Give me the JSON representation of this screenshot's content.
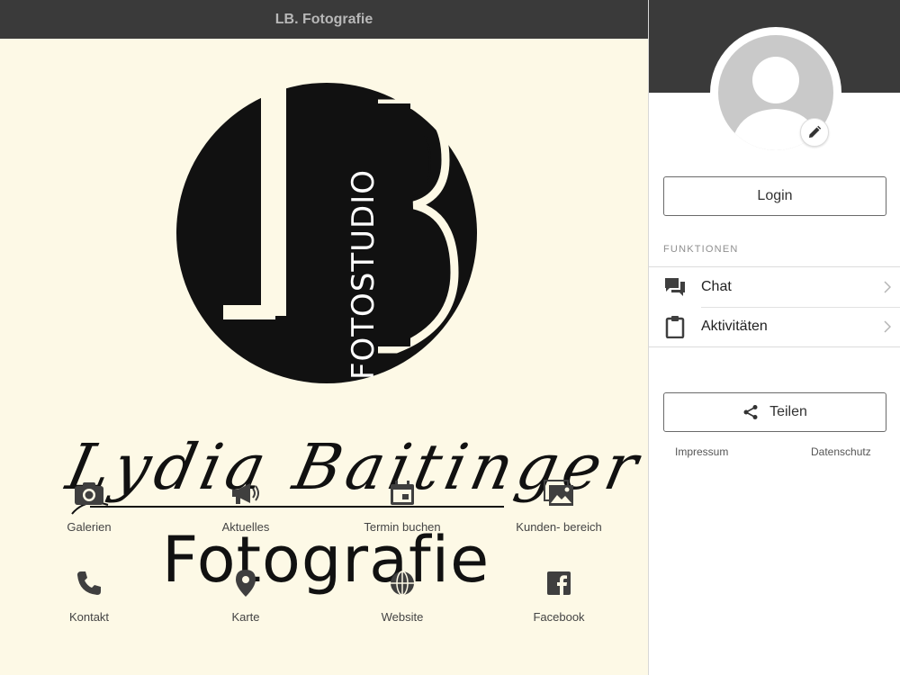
{
  "app": {
    "title": "LB. Fotografie"
  },
  "logo": {
    "vertical_text": "FOTOSTUDIO",
    "name_script": "Lydia Baitinger",
    "subtitle": "Fotografie",
    "ink_color": "#111111",
    "background_color": "#fdf9e6"
  },
  "tiles": [
    {
      "label": "Galerien",
      "icon": "camera-icon"
    },
    {
      "label": "Aktuelles",
      "icon": "megaphone-icon"
    },
    {
      "label": "Termin buchen",
      "icon": "calendar-icon"
    },
    {
      "label": "Kunden- bereich",
      "icon": "photos-icon"
    },
    {
      "label": "Kontakt",
      "icon": "phone-icon"
    },
    {
      "label": "Karte",
      "icon": "map-pin-icon"
    },
    {
      "label": "Website",
      "icon": "globe-icon"
    },
    {
      "label": "Facebook",
      "icon": "facebook-icon"
    }
  ],
  "sidebar": {
    "login_label": "Login",
    "section_title": "FUNKTIONEN",
    "items": [
      {
        "label": "Chat",
        "icon": "chat-icon"
      },
      {
        "label": "Aktivitäten",
        "icon": "clipboard-icon"
      }
    ],
    "share_label": "Teilen",
    "footer": {
      "impressum": "Impressum",
      "datenschutz": "Datenschutz"
    }
  },
  "colors": {
    "header_dark": "#3a3a3a",
    "icon_gray": "#3f3f3f",
    "avatar_gray": "#c9c9c9"
  }
}
